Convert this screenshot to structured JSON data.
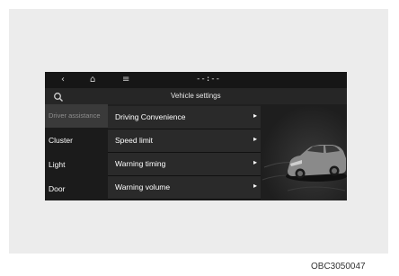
{
  "statusbar": {
    "back_icon": "back-arrow-icon",
    "home_icon": "home-icon",
    "menu_icon": "menu-icon",
    "center_text": "--:--"
  },
  "header": {
    "title": "Vehicle settings",
    "search_icon": "search-icon"
  },
  "sidebar": {
    "items": [
      {
        "label": "Driver assistance",
        "selected": true
      },
      {
        "label": "Cluster",
        "selected": false
      },
      {
        "label": "Light",
        "selected": false
      },
      {
        "label": "Door",
        "selected": false
      }
    ]
  },
  "menu": {
    "items": [
      {
        "label": "Driving Convenience"
      },
      {
        "label": "Speed limit"
      },
      {
        "label": "Warning timing"
      },
      {
        "label": "Warning volume"
      }
    ],
    "chevron_icon": "chevron-right-icon"
  },
  "image_code": "OBC3050047"
}
